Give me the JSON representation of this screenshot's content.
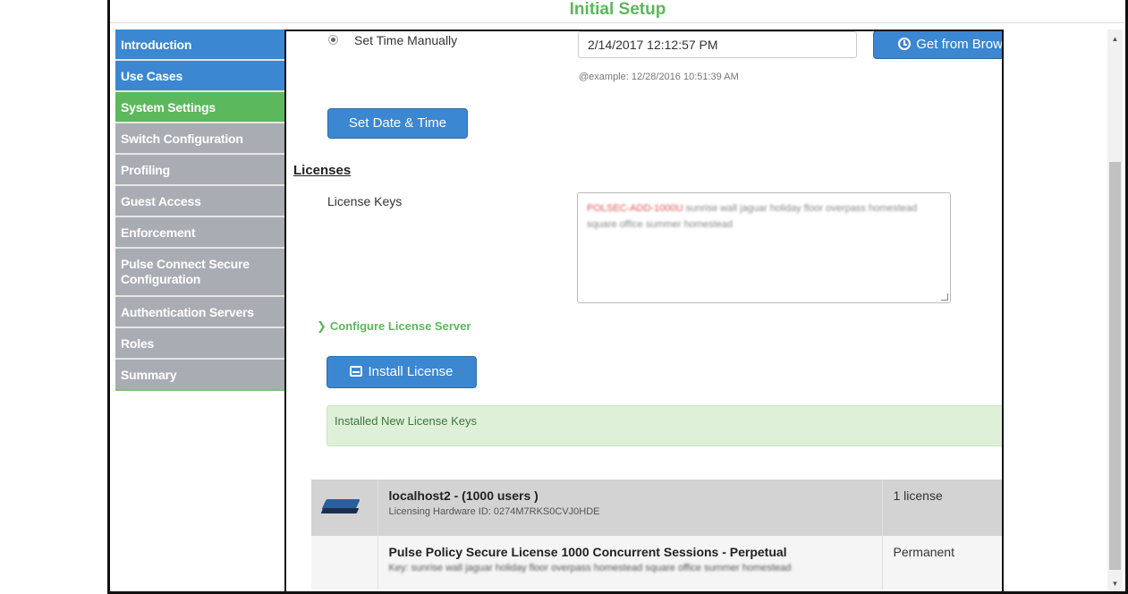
{
  "app": {
    "title": "Initial Setup"
  },
  "sidebar": {
    "items": [
      {
        "label": "Introduction",
        "state": "done"
      },
      {
        "label": "Use Cases",
        "state": "done"
      },
      {
        "label": "System Settings",
        "state": "active"
      },
      {
        "label": "Switch Configuration",
        "state": "pending"
      },
      {
        "label": "Profiling",
        "state": "pending"
      },
      {
        "label": "Guest Access",
        "state": "pending"
      },
      {
        "label": "Enforcement",
        "state": "pending"
      },
      {
        "label": "Pulse Connect Secure Configuration",
        "state": "pending"
      },
      {
        "label": "Authentication Servers",
        "state": "pending"
      },
      {
        "label": "Roles",
        "state": "pending"
      },
      {
        "label": "Summary",
        "state": "pending"
      }
    ]
  },
  "time": {
    "radio_label": "Set Time Manually",
    "value": "2/14/2017 12:12:57 PM",
    "example": "@example: 12/28/2016 10:51:39 AM",
    "browser_button": "Get from Browser",
    "set_button": "Set Date & Time"
  },
  "licenses": {
    "section_title": "Licenses",
    "keys_label": "License Keys",
    "keys_value_prefix": "POLSEC-ADD-1000U",
    "keys_value_rest": " sunrise wall jaguar holiday floor overpass homestead square office summer homestead",
    "configure_link": "Configure License Server",
    "install_button": "Install License",
    "alert_text": "Installed New License Keys",
    "device": {
      "name": "localhost2 - (1000 users )",
      "hardware_id": "Licensing Hardware ID: 0274M7RKS0CVJ0HDE",
      "count": "1 license"
    },
    "license": {
      "name": "Pulse Policy Secure License 1000 Concurrent Sessions - Perpetual",
      "key_line": "Key: sunrise wall jaguar holiday floor overpass homestead square office summer homestead",
      "term": "Permanent"
    }
  },
  "colors": {
    "accent_blue": "#3b87d1",
    "accent_green": "#5cb85c",
    "pending_gray": "#a9adb3"
  }
}
